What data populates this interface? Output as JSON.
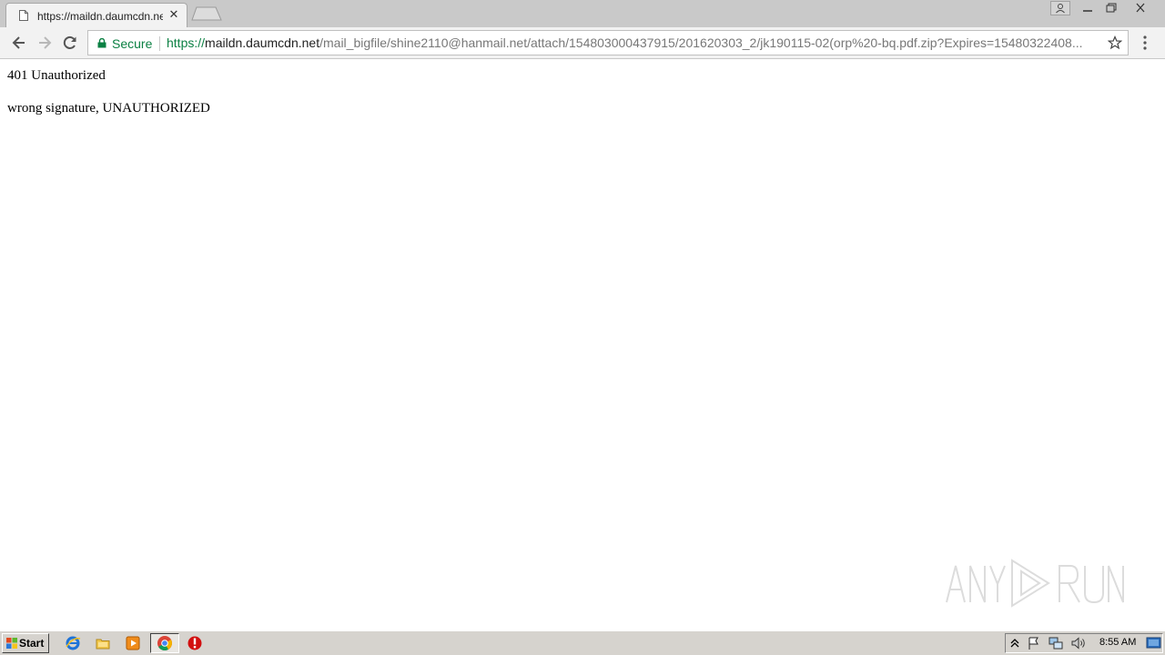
{
  "browser": {
    "tab_title": "https://maildn.daumcdn.net",
    "secure_label": "Secure",
    "url_scheme": "https://",
    "url_host": "maildn.daumcdn.net",
    "url_path": "/mail_bigfile/shine2110@hanmail.net/attach/154803000437915/201620303_2/jk190115-02(orp%20-bq.pdf.zip?Expires=15480322408..."
  },
  "page": {
    "heading": "401 Unauthorized",
    "message": "wrong signature, UNAUTHORIZED"
  },
  "taskbar": {
    "start_label": "Start",
    "clock": "8:55 AM"
  },
  "watermark": "ANY RUN",
  "colors": {
    "secure_green": "#0b8043",
    "taskbar": "#d6d3ce"
  }
}
